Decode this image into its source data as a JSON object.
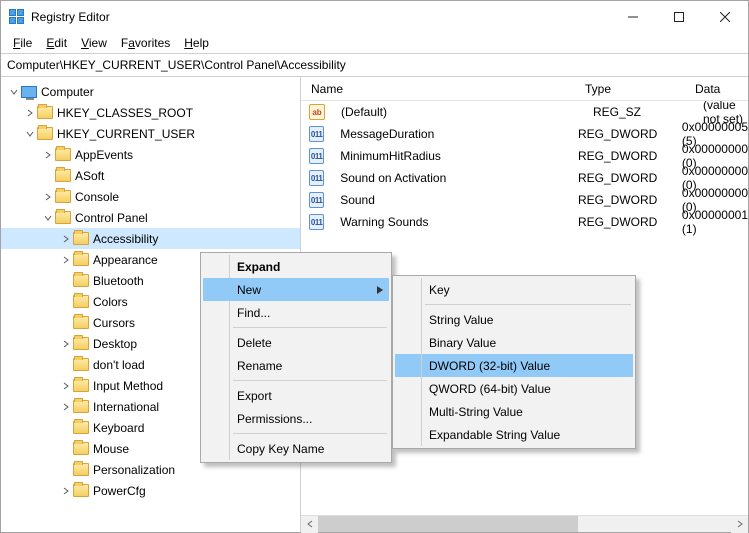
{
  "window": {
    "title": "Registry Editor"
  },
  "menubar": {
    "file": "File",
    "edit": "Edit",
    "view": "View",
    "favorites": "Favorites",
    "help": "Help"
  },
  "address": "Computer\\HKEY_CURRENT_USER\\Control Panel\\Accessibility",
  "columns": {
    "name": "Name",
    "type": "Type",
    "data": "Data"
  },
  "values": [
    {
      "name": "(Default)",
      "type": "REG_SZ",
      "data": "(value not set)",
      "kind": "str"
    },
    {
      "name": "MessageDuration",
      "type": "REG_DWORD",
      "data": "0x00000005 (5)",
      "kind": "bin"
    },
    {
      "name": "MinimumHitRadius",
      "type": "REG_DWORD",
      "data": "0x00000000 (0)",
      "kind": "bin"
    },
    {
      "name": "Sound on Activation",
      "type": "REG_DWORD",
      "data": "0x00000000 (0)",
      "kind": "bin"
    },
    {
      "name": "Sound",
      "type": "REG_DWORD",
      "data": "0x00000000 (0)",
      "kind": "bin"
    },
    {
      "name": "Warning Sounds",
      "type": "REG_DWORD",
      "data": "0x00000001 (1)",
      "kind": "bin"
    }
  ],
  "tree": {
    "root": "Computer",
    "hives": {
      "hkcr": "HKEY_CLASSES_ROOT",
      "hkcu": "HKEY_CURRENT_USER"
    },
    "hkcu_children": {
      "appEvents": "AppEvents",
      "asoft": "ASoft",
      "console": "Console",
      "controlPanel": "Control Panel"
    },
    "control_panel_children": [
      "Accessibility",
      "Appearance",
      "Bluetooth",
      "Colors",
      "Cursors",
      "Desktop",
      "don't load",
      "Input Method",
      "International",
      "Keyboard",
      "Mouse",
      "Personalization",
      "PowerCfg"
    ]
  },
  "context_menu": {
    "expand": "Expand",
    "new": "New",
    "find": "Find...",
    "delete": "Delete",
    "rename": "Rename",
    "export": "Export",
    "permissions": "Permissions...",
    "copyKeyName": "Copy Key Name"
  },
  "new_submenu": {
    "key": "Key",
    "string": "String Value",
    "binary": "Binary Value",
    "dword": "DWORD (32-bit) Value",
    "qword": "QWORD (64-bit) Value",
    "multi": "Multi-String Value",
    "expand": "Expandable String Value"
  }
}
